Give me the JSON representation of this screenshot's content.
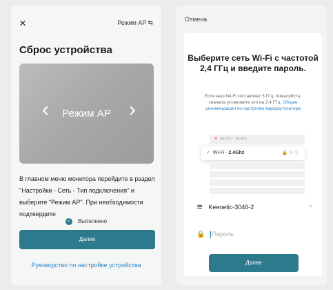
{
  "left": {
    "close_icon": "×",
    "mode_link": "Режим AP",
    "title": "Сброс устройства",
    "banner": {
      "prev": "‹",
      "label": "Режим AP",
      "next": "›"
    },
    "description": "В главном меню монитора перейдите в раздел \"Настройки - Сеть - Тип подключения\" и выберите \"Режим AP\". При необходимости подтвердите",
    "done_label": "Выполнено",
    "next_button": "Далее",
    "guide_link": "Руководство по настройке устройства"
  },
  "right": {
    "cancel": "Отмена",
    "title": "Выберите сеть Wi-Fi с частотой 2,4 ГГц и введите пароль.",
    "hint": "Если ваш Wi-Fi составляет 5 ГГц, пожалуйста, сначала установите его на 2,4 ГГц.",
    "hint_link": "Общие рекомендации по настройке маршрутизатора",
    "illustration": {
      "row1": "Wi-Fi - 5Ghz",
      "row2_prefix": "Wi-Fi - ",
      "row2_bold": "2.4Ghz"
    },
    "network_name": "Keenetic-3046-2",
    "password_placeholder": "Пароль",
    "next_button": "Далее"
  },
  "colors": {
    "accent": "#2c7a8b",
    "link": "#2f86c8"
  }
}
